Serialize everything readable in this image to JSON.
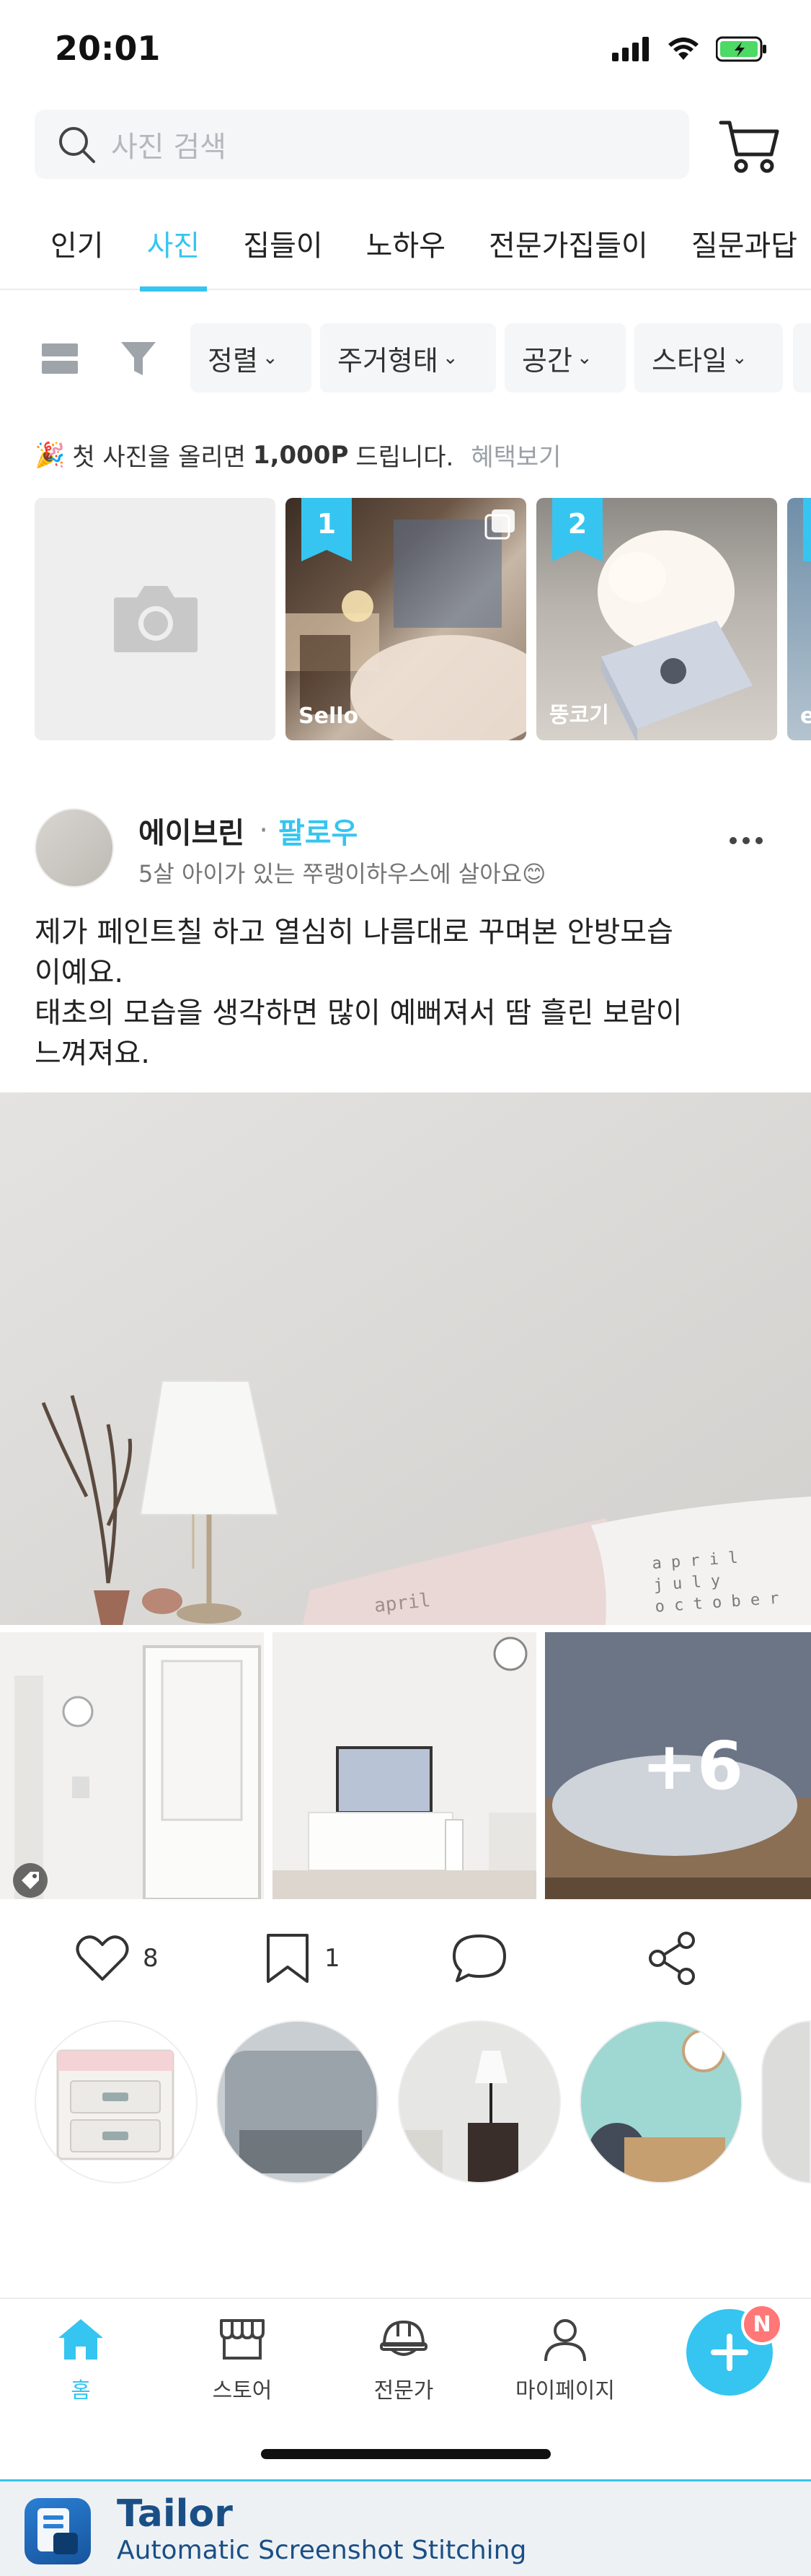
{
  "status_bar": {
    "time": "20:01",
    "battery_color": "#4cd964"
  },
  "search": {
    "placeholder": "사진 검색"
  },
  "tabs": [
    {
      "label": "인기",
      "active": false
    },
    {
      "label": "사진",
      "active": true
    },
    {
      "label": "집들이",
      "active": false
    },
    {
      "label": "노하우",
      "active": false
    },
    {
      "label": "전문가집들이",
      "active": false
    },
    {
      "label": "질문과답",
      "active": false
    }
  ],
  "filters": [
    {
      "label": "정렬"
    },
    {
      "label": "주거형태"
    },
    {
      "label": "공간"
    },
    {
      "label": "스타일"
    }
  ],
  "promo": {
    "emoji": "🎉",
    "text_before": "첫 사진을 올리면",
    "points": "1,000P",
    "text_after": "드립니다.",
    "link": "혜택보기"
  },
  "ranking": [
    {
      "rank": "1",
      "user": "Sello"
    },
    {
      "rank": "2",
      "user": "뚱코기"
    },
    {
      "rank": "",
      "user": "e"
    }
  ],
  "post": {
    "author": "에이브린",
    "separator": "·",
    "follow_label": "팔로우",
    "bio": "5살 아이가 있는 쭈랭이하우스에 살아요😊",
    "text_line1": "제가 페인트칠 하고 열심히 나름대로 꾸며본 안방모습",
    "text_line2": "이예요.",
    "text_line3": "태초의 모습을 생각하면 많이 예뻐져서 땀 흘린 보람이",
    "text_line4": "느껴져요.",
    "pillow_text": "april",
    "pillow_text2": "april\njuly\noctober",
    "more_photos": "+6",
    "likes": "8",
    "bookmarks": "1"
  },
  "bottom_nav": [
    {
      "label": "홈",
      "active": true
    },
    {
      "label": "스토어",
      "active": false
    },
    {
      "label": "전문가",
      "active": false
    },
    {
      "label": "마이페이지",
      "active": false
    }
  ],
  "fab_badge": "N",
  "tailor": {
    "name": "Tailor",
    "subtitle": "Automatic Screenshot Stitching"
  },
  "colors": {
    "accent": "#35c5f0",
    "badge": "#ff7777"
  }
}
